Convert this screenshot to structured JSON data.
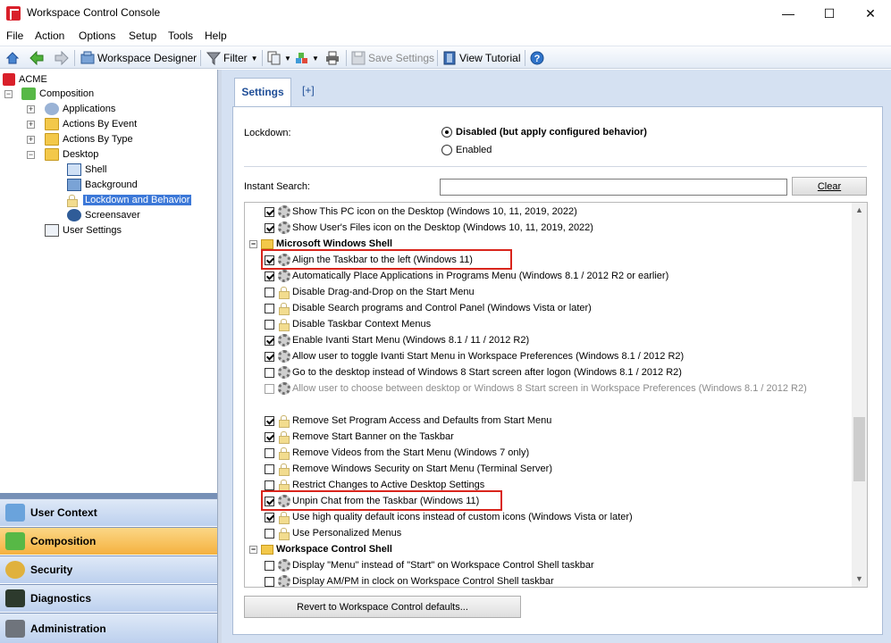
{
  "window": {
    "title": "Workspace Control Console",
    "minimize": "—",
    "maximize": "☐",
    "close": "✕"
  },
  "menu": [
    "File",
    "Action",
    "Options",
    "Setup",
    "Tools",
    "Help"
  ],
  "toolbar": {
    "workspace_designer": "Workspace Designer",
    "filter": "Filter",
    "save_settings": "Save Settings",
    "view_tutorial": "View Tutorial"
  },
  "tree": {
    "root": "ACME",
    "composition": "Composition",
    "applications": "Applications",
    "actions_by_event": "Actions By Event",
    "actions_by_type": "Actions By Type",
    "desktop": "Desktop",
    "shell": "Shell",
    "background": "Background",
    "lockdown": "Lockdown and Behavior",
    "screensaver": "Screensaver",
    "user_settings": "User Settings"
  },
  "nav": [
    "User Context",
    "Composition",
    "Security",
    "Diagnostics",
    "Administration"
  ],
  "tabs": {
    "settings": "Settings",
    "add": "[+]"
  },
  "lockdown": {
    "label": "Lockdown:",
    "option_disabled": "Disabled (but apply configured behavior)",
    "option_enabled": "Enabled",
    "selected": "disabled"
  },
  "search": {
    "label": "Instant Search:",
    "value": "",
    "clear": "Clear"
  },
  "items": [
    {
      "text": "Show This PC icon on the Desktop (Windows 10, 11, 2019, 2022)",
      "checked": true,
      "icon": "gear-icon"
    },
    {
      "text": "Show User's Files icon on the Desktop (Windows 10, 11, 2019, 2022)",
      "checked": true,
      "icon": "gear-icon"
    },
    {
      "text": "Microsoft Windows Shell",
      "group": true
    },
    {
      "text": "Align the Taskbar to the left (Windows 11)",
      "checked": true,
      "icon": "gear-icon",
      "highlight": true
    },
    {
      "text": "Automatically Place Applications in Programs Menu (Windows 8.1 / 2012 R2 or earlier)",
      "checked": true,
      "icon": "gear-icon"
    },
    {
      "text": "Disable Drag-and-Drop on the Start Menu",
      "checked": false,
      "icon": "lock-icon"
    },
    {
      "text": "Disable Search programs and Control Panel (Windows Vista or later)",
      "checked": false,
      "icon": "lock-icon"
    },
    {
      "text": "Disable Taskbar Context Menus",
      "checked": false,
      "icon": "lock-icon"
    },
    {
      "text": "Enable Ivanti Start Menu (Windows 8.1 / 11 / 2012 R2)",
      "checked": true,
      "icon": "gear-icon"
    },
    {
      "text": "Allow user to toggle Ivanti Start Menu in Workspace Preferences (Windows 8.1 / 2012 R2)",
      "checked": true,
      "icon": "gear-icon"
    },
    {
      "text": "Go to the desktop instead of Windows 8 Start screen after logon (Windows 8.1 / 2012 R2)",
      "checked": false,
      "icon": "gear-icon"
    },
    {
      "text": "Allow user to choose between desktop or Windows 8 Start screen in Workspace Preferences (Windows 8.1 / 2012 R2)",
      "checked": false,
      "icon": "gear-icon",
      "disabled": true
    },
    {
      "text": "",
      "spacer": true
    },
    {
      "text": "Remove Set Program Access and Defaults from Start Menu",
      "checked": true,
      "icon": "lock-icon"
    },
    {
      "text": "Remove Start Banner on the Taskbar",
      "checked": true,
      "icon": "lock-icon"
    },
    {
      "text": "Remove Videos from the Start Menu (Windows 7 only)",
      "checked": false,
      "icon": "lock-icon"
    },
    {
      "text": "Remove Windows Security on Start Menu (Terminal Server)",
      "checked": false,
      "icon": "lock-icon"
    },
    {
      "text": "Restrict Changes to Active Desktop Settings",
      "checked": false,
      "icon": "lock-icon"
    },
    {
      "text": "Unpin Chat from the Taskbar (Windows 11)",
      "checked": true,
      "icon": "gear-icon",
      "highlight": true
    },
    {
      "text": "Use high quality default icons instead of custom icons (Windows Vista or later)",
      "checked": true,
      "icon": "lock-icon"
    },
    {
      "text": "Use Personalized Menus",
      "checked": false,
      "icon": "lock-icon"
    },
    {
      "text": "Workspace Control Shell",
      "group": true
    },
    {
      "text": "Display \"Menu\" instead of \"Start\" on Workspace Control Shell taskbar",
      "checked": false,
      "icon": "gear-icon"
    },
    {
      "text": "Display AM/PM in clock on Workspace Control Shell taskbar",
      "checked": false,
      "icon": "gear-icon"
    }
  ],
  "revert_button": "Revert to Workspace Control defaults..."
}
